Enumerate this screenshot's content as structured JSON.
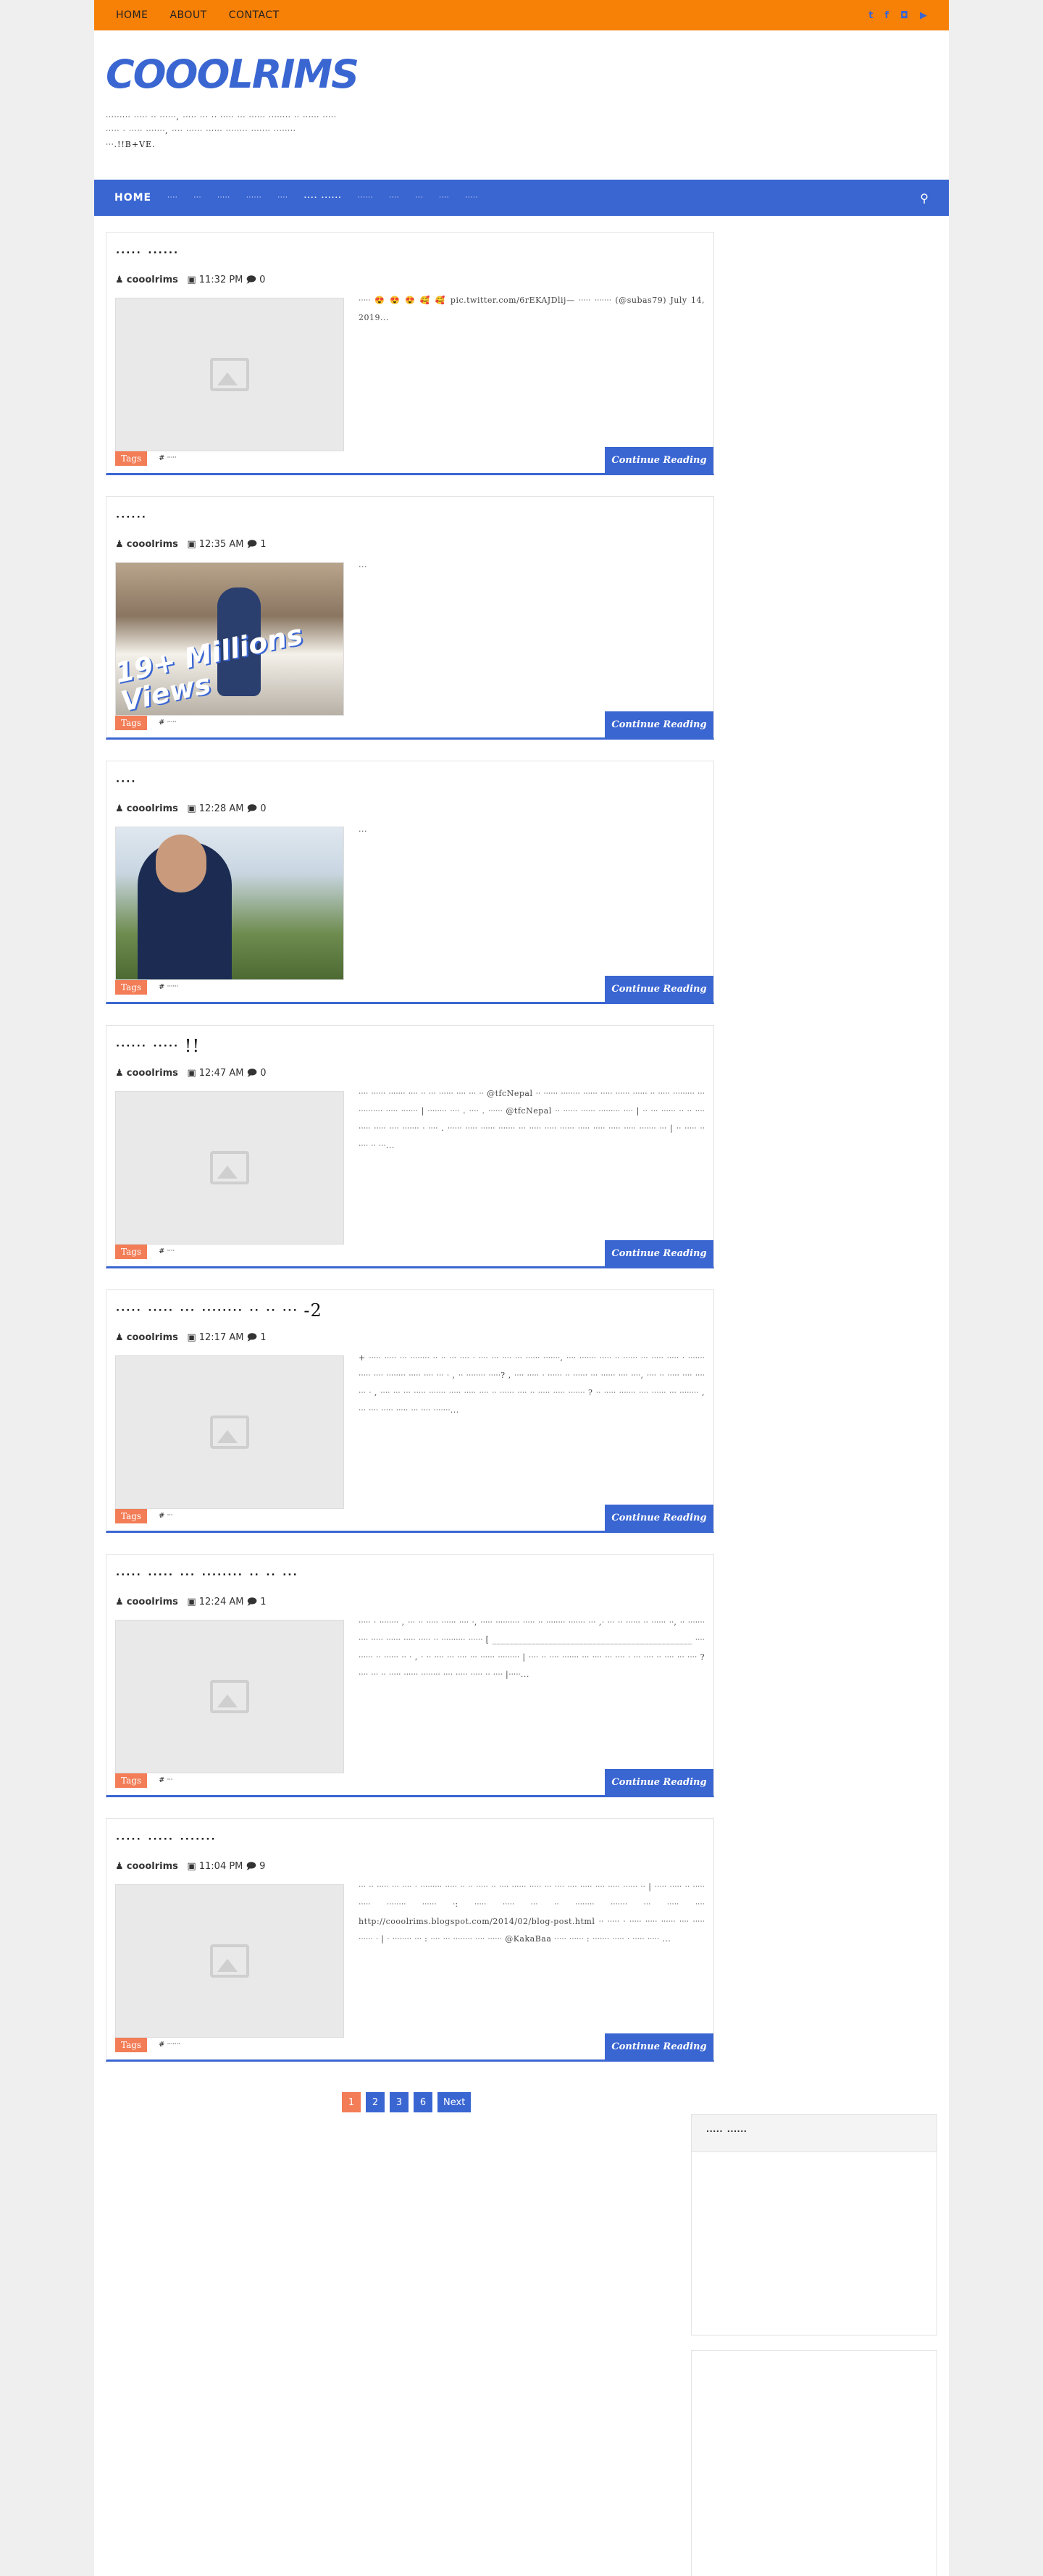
{
  "topbar": {
    "nav": [
      "HOME",
      "ABOUT",
      "CONTACT"
    ],
    "social": [
      "twitter-icon",
      "facebook-icon",
      "instagram-icon",
      "youtube-icon"
    ]
  },
  "header": {
    "logo": "COOOLRIMS",
    "tagline": "ᐧᐧᐧᐧᐧᐧᐧᐧᐧ ᐧᐧᐧᐧᐧ ᐧᐧ ᐧᐧᐧᐧᐧᐧ, ᐧᐧᐧᐧᐧ ᐧᐧᐧ ᐧᐧ ᐧᐧᐧᐧᐧ ᐧᐧᐧ ᐧᐧᐧᐧᐧᐧ ᐧᐧᐧᐧᐧᐧᐧᐧ ᐧᐧ ᐧᐧᐧᐧᐧᐧ ᐧᐧᐧᐧᐧ ᐧᐧᐧᐧᐧ ᐧ ᐧᐧᐧᐧᐧ ᐧᐧᐧᐧᐧᐧᐧ, ᐧᐧᐧᐧ ᐧᐧᐧᐧᐧᐧ ᐧᐧᐧᐧᐧᐧ ᐧᐧᐧᐧᐧᐧᐧᐧ ᐧᐧᐧᐧᐧᐧᐧ ᐧᐧᐧᐧᐧᐧᐧᐧ ᐧᐧᐧ.!!B+VE."
  },
  "mainnav": {
    "items": [
      "HOME",
      "ᐧᐧᐧᐧ",
      "ᐧᐧᐧ",
      "ᐧᐧᐧᐧᐧ",
      "ᐧᐧᐧᐧᐧᐧ",
      "ᐧᐧᐧᐧ",
      "ᐧᐧᐧᐧ ᐧᐧᐧᐧᐧᐧ",
      "ᐧᐧᐧᐧᐧᐧ",
      "ᐧᐧᐧᐧ",
      "ᐧᐧᐧ",
      "ᐧᐧᐧᐧ",
      "ᐧᐧᐧᐧᐧ"
    ],
    "search_icon": "search-icon"
  },
  "posts": [
    {
      "title": "ᐧᐧᐧᐧᐧ ᐧᐧᐧᐧᐧᐧ",
      "author": "cooolrims",
      "time": "11:32 PM",
      "comments": "0",
      "excerpt": "ᐧᐧᐧᐧᐧ 😍 😍 😍 🥰 🥰   pic.twitter.com/6rEKAJDlij— ᐧᐧᐧᐧᐧ ᐧᐧᐧᐧᐧᐧᐧ (@subas79) July 14, 2019...",
      "tags_label": "Tags",
      "tag": "# ᐧᐧᐧᐧᐧ",
      "more": "Continue Reading",
      "thumb": "placeholder"
    },
    {
      "title": "ᐧᐧᐧᐧᐧᐧ",
      "author": "cooolrims",
      "time": "12:35 AM",
      "comments": "1",
      "excerpt": "...",
      "tags_label": "Tags",
      "tag": "# ᐧᐧᐧᐧᐧ",
      "more": "Continue Reading",
      "thumb": "photo-child",
      "overlay": "19+ Millions Views"
    },
    {
      "title": "ᐧᐧᐧᐧ",
      "author": "cooolrims",
      "time": "12:28 AM",
      "comments": "0",
      "excerpt": "...",
      "tags_label": "Tags",
      "tag": "# ᐧᐧᐧᐧᐧᐧ",
      "more": "Continue Reading",
      "thumb": "photo-selfie"
    },
    {
      "title": "ᐧᐧᐧᐧᐧᐧ ᐧᐧᐧᐧᐧ !!",
      "author": "cooolrims",
      "time": "12:47 AM",
      "comments": "0",
      "excerpt": "ᐧᐧᐧᐧ ᐧᐧᐧᐧᐧᐧ ᐧᐧᐧᐧᐧᐧᐧ ᐧᐧᐧᐧ ᐧᐧ ᐧᐧᐧ ᐧᐧᐧᐧᐧᐧ ᐧᐧᐧᐧ ᐧᐧᐧ ᐧᐧ @tfcNepal ᐧᐧ ᐧᐧᐧᐧᐧᐧ ᐧᐧᐧᐧᐧᐧᐧᐧ ᐧᐧᐧᐧᐧᐧ ᐧᐧᐧᐧᐧ  ᐧᐧᐧᐧᐧᐧ  ᐧᐧᐧᐧᐧᐧ ᐧᐧ ᐧᐧᐧᐧᐧ ᐧᐧᐧᐧᐧᐧᐧᐧᐧ ᐧᐧᐧ ᐧᐧᐧᐧᐧᐧᐧᐧᐧᐧ ᐧᐧᐧᐧᐧ ᐧᐧᐧᐧᐧᐧᐧ | ᐧᐧᐧᐧᐧᐧᐧᐧ ᐧᐧᐧᐧ . ᐧᐧᐧᐧ . ᐧᐧᐧᐧᐧᐧ @tfcNepal ᐧᐧ ᐧᐧᐧᐧᐧᐧ ᐧᐧᐧᐧᐧᐧ ᐧᐧᐧᐧᐧᐧᐧᐧᐧ ᐧᐧᐧᐧ | ᐧᐧ ᐧᐧᐧ ᐧᐧᐧᐧᐧᐧ ᐧᐧ ᐧᐧ ᐧᐧᐧᐧ ᐧᐧᐧᐧᐧ ᐧᐧᐧᐧᐧ ᐧᐧᐧᐧ ᐧᐧᐧᐧᐧᐧᐧ ᐧ ᐧᐧᐧᐧ . ᐧᐧᐧᐧᐧᐧ ᐧᐧᐧᐧᐧ ᐧᐧᐧᐧᐧᐧ ᐧᐧᐧᐧᐧᐧᐧ ᐧᐧᐧ ᐧᐧᐧᐧᐧ ᐧᐧᐧᐧᐧ ᐧᐧᐧᐧᐧᐧ ᐧᐧᐧᐧᐧ ᐧᐧᐧᐧᐧ ᐧᐧᐧᐧᐧ ᐧᐧᐧᐧᐧ ᐧᐧᐧᐧᐧᐧᐧ ᐧᐧᐧ | ᐧᐧ ᐧᐧᐧᐧᐧ ᐧᐧ ᐧᐧᐧᐧ ᐧᐧ ᐧᐧᐧ...",
      "tags_label": "Tags",
      "tag": "# ᐧᐧᐧᐧ",
      "more": "Continue Reading",
      "thumb": "placeholder"
    },
    {
      "title": "ᐧᐧᐧᐧᐧ ᐧᐧᐧᐧᐧ ᐧᐧᐧ ᐧᐧᐧᐧᐧᐧᐧᐧ ᐧᐧ ᐧᐧ ᐧᐧᐧ -2",
      "author": "cooolrims",
      "time": "12:17 AM",
      "comments": "1",
      "excerpt": "+ ᐧᐧᐧᐧᐧ ᐧᐧᐧᐧᐧ ᐧᐧᐧ ᐧᐧᐧᐧᐧᐧᐧᐧ ᐧᐧ ᐧᐧ ᐧᐧᐧ ᐧᐧᐧᐧ ᐧ ᐧᐧᐧᐧ ᐧᐧᐧ ᐧᐧᐧᐧ ᐧᐧᐧ ᐧᐧᐧᐧᐧᐧ ᐧᐧᐧᐧᐧᐧᐧ, ᐧᐧᐧᐧ ᐧᐧᐧᐧᐧᐧᐧ ᐧᐧᐧᐧᐧ ᐧᐧ ᐧᐧᐧᐧᐧᐧ ᐧᐧᐧ ᐧᐧᐧᐧᐧ ᐧᐧᐧᐧᐧ ᐧ ᐧᐧᐧᐧᐧᐧᐧ ᐧᐧᐧᐧᐧ ᐧᐧᐧᐧ ᐧᐧᐧᐧᐧᐧᐧᐧ ᐧᐧᐧᐧᐧ ᐧᐧᐧᐧ ᐧᐧᐧ ᐧ , ᐧᐧ ᐧᐧᐧᐧᐧᐧᐧᐧ ᐧᐧᐧᐧᐧ? , ᐧᐧᐧᐧ ᐧᐧᐧᐧᐧ ᐧ ᐧᐧᐧᐧᐧᐧ ᐧᐧ ᐧᐧᐧᐧᐧᐧ ᐧᐧᐧ ᐧᐧᐧᐧᐧᐧ ᐧᐧᐧᐧ ᐧᐧᐧᐧ, ᐧᐧᐧᐧ ᐧᐧ ᐧᐧᐧᐧᐧ  ᐧᐧᐧᐧ ᐧᐧᐧᐧ ᐧᐧᐧ ᐧ ,  ᐧᐧᐧᐧ ᐧᐧᐧ ᐧᐧᐧ ᐧᐧᐧᐧᐧ ᐧᐧᐧᐧᐧᐧᐧ ᐧᐧᐧᐧᐧ ᐧᐧᐧᐧᐧ ᐧᐧᐧᐧ ᐧᐧ ᐧᐧᐧᐧᐧᐧ ᐧᐧᐧᐧ ᐧᐧ ᐧᐧᐧᐧᐧ ᐧᐧᐧᐧᐧ ᐧᐧᐧᐧᐧᐧᐧ ? ᐧᐧ ᐧᐧᐧᐧᐧ ᐧᐧᐧᐧᐧᐧᐧ ᐧᐧᐧᐧ ᐧᐧᐧᐧᐧᐧ ᐧᐧᐧ ᐧᐧᐧᐧᐧᐧᐧᐧ , ᐧᐧᐧ ᐧᐧᐧᐧ ᐧᐧᐧᐧᐧ ᐧᐧᐧᐧᐧ ᐧᐧᐧ ᐧᐧᐧᐧ ᐧᐧᐧᐧᐧᐧᐧ...",
      "tags_label": "Tags",
      "tag": "# ᐧᐧᐧ",
      "more": "Continue Reading",
      "thumb": "placeholder"
    },
    {
      "title": "ᐧᐧᐧᐧᐧ ᐧᐧᐧᐧᐧ ᐧᐧᐧ ᐧᐧᐧᐧᐧᐧᐧᐧ ᐧᐧ ᐧᐧ ᐧᐧᐧ",
      "author": "cooolrims",
      "time": "12:24 AM",
      "comments": "1",
      "excerpt": "ᐧᐧᐧᐧᐧ ᐧ ᐧᐧᐧᐧᐧᐧᐧᐧ , ᐧᐧᐧ ᐧᐧ ᐧᐧᐧᐧᐧ ᐧᐧᐧᐧᐧᐧ ᐧᐧᐧᐧ ᐧ, ᐧᐧᐧᐧᐧ ᐧᐧᐧᐧᐧᐧᐧᐧᐧᐧ ᐧᐧᐧᐧᐧ ᐧᐧ ᐧᐧᐧᐧᐧᐧᐧᐧ ᐧᐧᐧᐧᐧᐧᐧ ᐧᐧᐧ ,ᐧ ᐧᐧᐧ ᐧᐧ ᐧᐧᐧᐧᐧᐧ ᐧᐧ  ᐧᐧᐧᐧᐧᐧ ᐧᐧ, ᐧᐧ ᐧᐧᐧᐧᐧᐧᐧ ᐧᐧᐧᐧ ᐧᐧᐧᐧᐧ ᐧᐧᐧᐧᐧᐧ ᐧᐧᐧᐧᐧ ᐧᐧᐧᐧᐧ ᐧᐧ ᐧᐧᐧᐧᐧᐧᐧᐧᐧᐧ ᐧᐧᐧᐧᐧᐧ [ ______________________________________________ ᐧᐧᐧᐧ ᐧᐧᐧᐧᐧᐧ ᐧᐧ ᐧᐧᐧᐧᐧᐧ ᐧᐧ ᐧ , ᐧ ᐧᐧ ᐧᐧᐧᐧ ᐧᐧᐧ ᐧᐧᐧᐧ ᐧᐧᐧ ᐧᐧᐧᐧᐧᐧ ᐧᐧᐧᐧᐧᐧᐧᐧᐧ | ᐧᐧᐧᐧ ᐧᐧ ᐧᐧᐧᐧ ᐧᐧᐧᐧᐧᐧᐧ ᐧᐧᐧ ᐧᐧᐧᐧ ᐧᐧᐧ ᐧᐧᐧᐧ ᐧ ᐧᐧᐧ ᐧᐧᐧᐧ ᐧᐧ ᐧᐧᐧᐧ ᐧᐧᐧ ᐧᐧᐧᐧ ? ᐧᐧᐧᐧ ᐧᐧᐧ ᐧᐧ ᐧᐧᐧᐧᐧ ᐧᐧᐧᐧᐧᐧ ᐧᐧᐧᐧᐧᐧᐧᐧ ᐧᐧᐧᐧ ᐧᐧᐧᐧᐧ ᐧᐧᐧᐧᐧ ᐧᐧ ᐧᐧᐧᐧ |ᐧᐧᐧᐧᐧ...",
      "tags_label": "Tags",
      "tag": "# ᐧᐧᐧ",
      "more": "Continue Reading",
      "thumb": "placeholder"
    },
    {
      "title": "ᐧᐧᐧᐧᐧ ᐧᐧᐧᐧᐧ ᐧᐧᐧᐧᐧᐧᐧ",
      "author": "cooolrims",
      "time": "11:04 PM",
      "comments": "9",
      "excerpt": "ᐧᐧᐧ ᐧᐧ ᐧᐧᐧᐧᐧ ᐧᐧᐧ ᐧᐧᐧᐧ ᐧ ᐧᐧᐧᐧᐧᐧᐧᐧᐧ ᐧᐧᐧᐧᐧ ᐧᐧ ᐧᐧ ᐧᐧᐧᐧᐧ ᐧᐧ ᐧᐧᐧᐧ ᐧᐧᐧᐧᐧᐧ ᐧᐧᐧᐧᐧ ᐧᐧᐧ ᐧᐧᐧᐧ ᐧᐧᐧᐧ ᐧᐧᐧᐧᐧ ᐧᐧᐧᐧ ᐧᐧᐧᐧᐧ ᐧᐧᐧᐧᐧᐧ ᐧᐧ | ᐧᐧᐧᐧᐧ  ᐧᐧᐧᐧᐧ ᐧᐧ ᐧᐧᐧᐧᐧ ᐧᐧᐧᐧᐧ ᐧᐧᐧᐧᐧᐧᐧᐧ ᐧᐧᐧᐧᐧᐧ ᐧ:  ᐧᐧᐧᐧᐧ ᐧᐧᐧᐧᐧ ᐧᐧᐧ ᐧᐧ ᐧᐧᐧᐧᐧᐧᐧᐧ ᐧᐧᐧᐧᐧᐧᐧ  ᐧᐧᐧ ᐧᐧᐧᐧᐧ ᐧᐧᐧᐧ http://cooolrims.blogspot.com/2014/02/blog-post.html   ᐧᐧ ᐧᐧᐧᐧᐧ ᐧ ᐧᐧᐧᐧᐧ ᐧᐧᐧᐧᐧ ᐧᐧᐧᐧᐧᐧ  ᐧᐧᐧᐧ ᐧᐧᐧᐧᐧ ᐧᐧᐧᐧᐧᐧ ᐧ | ᐧ ᐧᐧᐧᐧᐧᐧᐧᐧ ᐧᐧᐧ : ᐧᐧᐧᐧ ᐧᐧᐧ ᐧᐧᐧᐧᐧᐧᐧᐧ ᐧᐧᐧᐧ ᐧᐧᐧᐧᐧᐧ @KakaBaa ᐧᐧᐧᐧᐧ ᐧᐧᐧᐧᐧᐧ : ᐧᐧᐧᐧᐧᐧᐧ ᐧᐧᐧᐧᐧ ᐧ ᐧᐧᐧᐧᐧ ᐧᐧᐧᐧᐧ ...",
      "tags_label": "Tags",
      "tag": "# ᐧᐧᐧᐧᐧᐧᐧ",
      "more": "Continue Reading",
      "thumb": "placeholder"
    }
  ],
  "pager": {
    "pages": [
      "1",
      "2",
      "3",
      "6"
    ],
    "next": "Next",
    "current": "1"
  },
  "sidebar": {
    "widget_title": "ᐧᐧᐧᐧᐧ ᐧᐧᐧᐧᐧᐧ"
  },
  "colors": {
    "accent": "#3a66d2",
    "topbar": "#f78007",
    "tag": "#f27d56"
  }
}
